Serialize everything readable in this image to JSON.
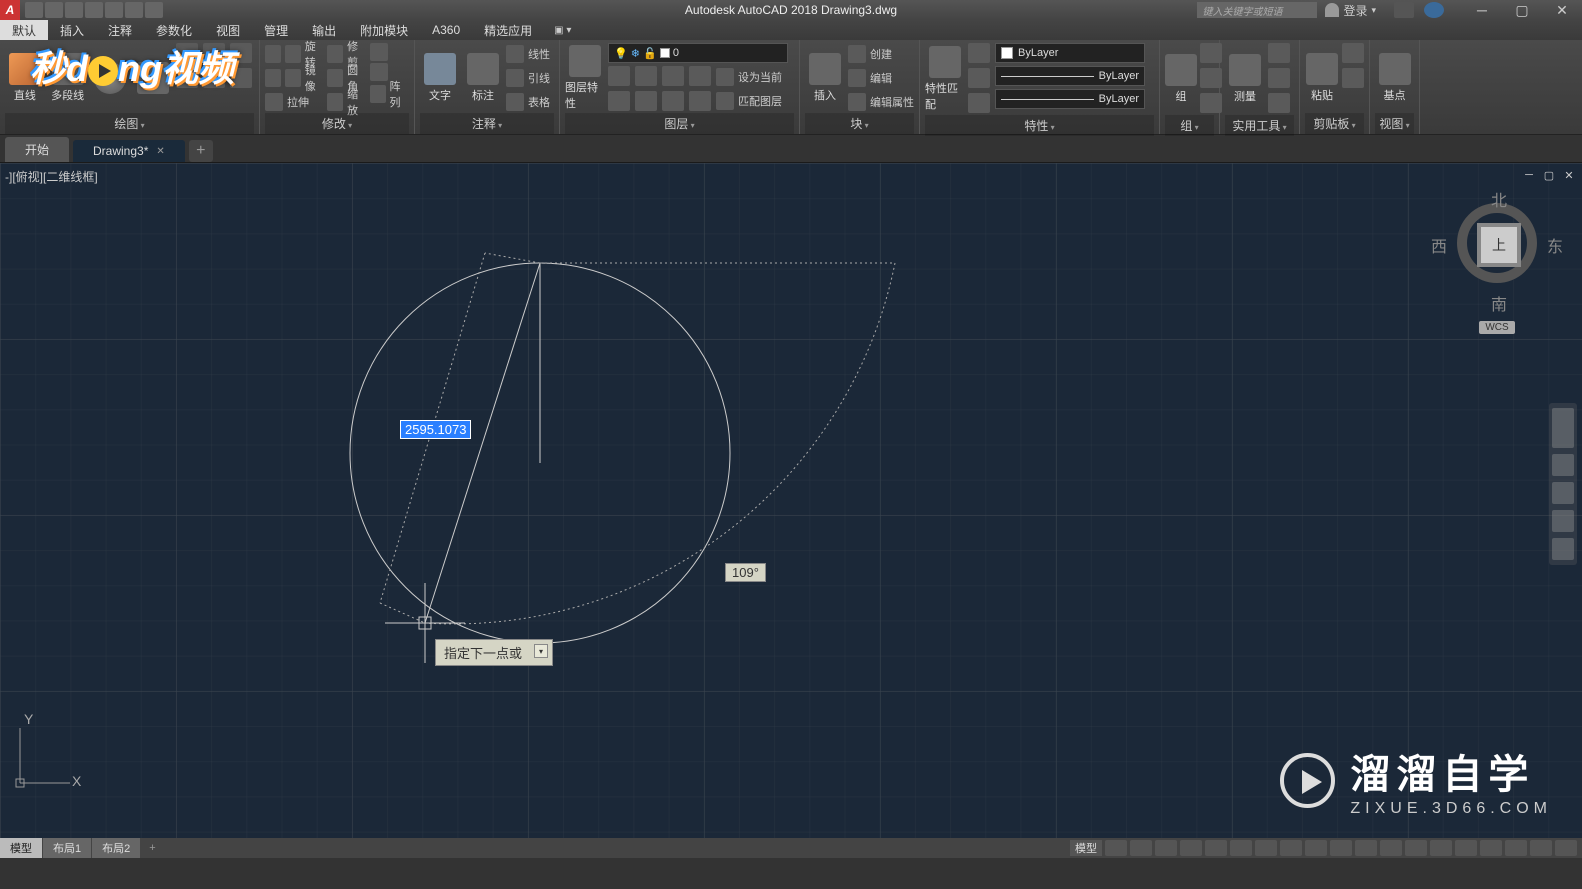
{
  "title": "Autodesk AutoCAD 2018   Drawing3.dwg",
  "header": {
    "search_placeholder": "键入关键字或短语",
    "login": "登录"
  },
  "ribbon_tabs": [
    "默认",
    "插入",
    "注释",
    "参数化",
    "视图",
    "管理",
    "输出",
    "附加模块",
    "A360",
    "精选应用"
  ],
  "ribbon": {
    "draw": {
      "label": "绘图",
      "line": "直线",
      "polyline": "多段线"
    },
    "modify": {
      "label": "修改",
      "rotate": "旋转",
      "trim": "修剪",
      "mirror": "镜像",
      "fillet": "圆角",
      "stretch": "拉伸",
      "scale": "缩放",
      "array": "阵列"
    },
    "annotation": {
      "label": "注释",
      "text": "文字",
      "dim": "标注",
      "linear": "线性",
      "leader": "引线",
      "table": "表格"
    },
    "layers": {
      "label": "图层",
      "props": "图层特性",
      "current": "设为当前",
      "match": "匹配图层",
      "layer_value": "0"
    },
    "block": {
      "label": "块",
      "insert": "插入",
      "create": "创建",
      "edit": "编辑",
      "edit_attr": "编辑属性"
    },
    "properties": {
      "label": "特性",
      "match": "特性匹配",
      "bylayer": "ByLayer"
    },
    "group": {
      "label": "组",
      "btn": "组"
    },
    "utils": {
      "label": "实用工具",
      "measure": "测量"
    },
    "clipboard": {
      "label": "剪贴板",
      "paste": "粘贴"
    },
    "view": {
      "label": "视图",
      "base": "基点"
    }
  },
  "file_tabs": {
    "start": "开始",
    "drawing": "Drawing3*"
  },
  "viewport_label": "-][俯视][二维线框]",
  "drawing": {
    "dim_value": "2595.1073",
    "angle_value": "109°",
    "tooltip": "指定下一点或"
  },
  "viewcube": {
    "face": "上",
    "n": "北",
    "s": "南",
    "e": "东",
    "w": "西",
    "wcs": "WCS"
  },
  "ucs": {
    "x": "X",
    "y": "Y"
  },
  "layout_tabs": [
    "模型",
    "布局1",
    "布局2"
  ],
  "status_model": "模型",
  "watermark": {
    "big": "溜溜自学",
    "small": "ZIXUE.3D66.COM"
  },
  "overlay_logo": {
    "t1": "秒d",
    "t2": "ng视频"
  }
}
